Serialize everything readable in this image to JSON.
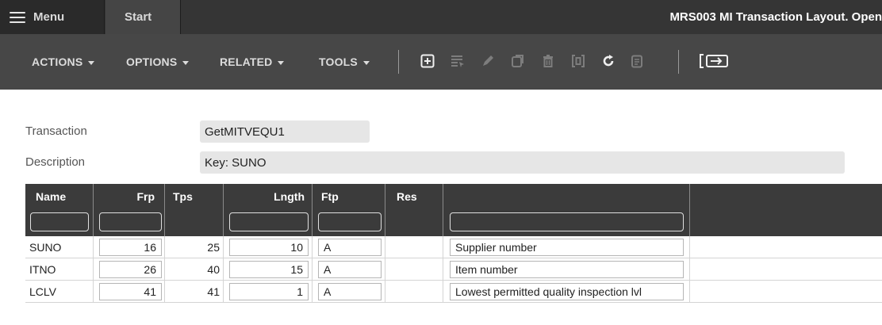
{
  "topbar": {
    "menu_label": "Menu",
    "start_tab": "Start",
    "window_title": "MRS003 MI Transaction Layout. Open"
  },
  "toolbar": {
    "menus": [
      "ACTIONS",
      "OPTIONS",
      "RELATED",
      "TOOLS"
    ],
    "icons": [
      "add-icon",
      "select-rows-icon",
      "edit-icon",
      "copy-icon",
      "delete-icon",
      "display-icon",
      "refresh-icon",
      "notes-icon",
      "close-panel-icon"
    ]
  },
  "form": {
    "transaction_label": "Transaction",
    "transaction_value": "GetMITVEQU1",
    "description_label": "Description",
    "description_value": "Key: SUNO"
  },
  "grid": {
    "columns": [
      "Name",
      "Frp",
      "Tps",
      "Lngth",
      "Ftp",
      "Res",
      ""
    ],
    "rows": [
      {
        "name": "SUNO",
        "frp": "16",
        "tps": "25",
        "lngth": "10",
        "ftp": "A",
        "res": "",
        "desc": "Supplier number"
      },
      {
        "name": "ITNO",
        "frp": "26",
        "tps": "40",
        "lngth": "15",
        "ftp": "A",
        "res": "",
        "desc": "Item number"
      },
      {
        "name": "LCLV",
        "frp": "41",
        "tps": "41",
        "lngth": "1",
        "ftp": "A",
        "res": "",
        "desc": "Lowest permitted quality inspection lvl"
      }
    ]
  },
  "colors": {
    "topbar_bg": "#353535",
    "toolbar_bg": "#474747",
    "grid_header_bg": "#3b3b3b",
    "field_bg": "#e6e6e6"
  }
}
